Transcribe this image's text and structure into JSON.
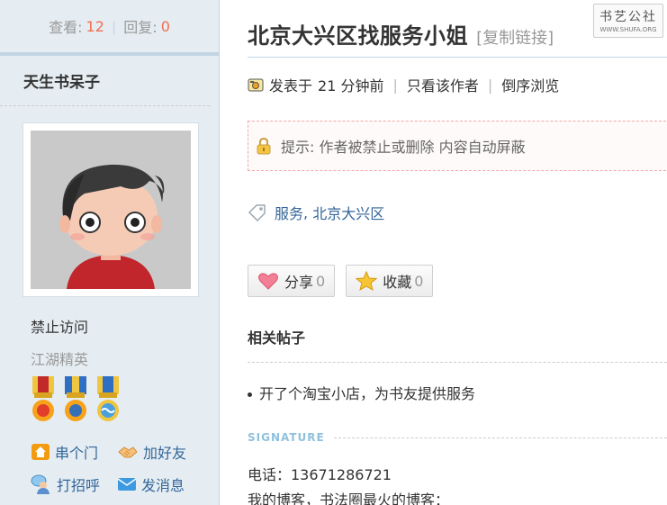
{
  "sidebar": {
    "views_label": "查看:",
    "views_count": "12",
    "separator": "|",
    "replies_label": "回复:",
    "replies_count": "0",
    "username": "天生书呆子",
    "status": "禁止访问",
    "rank": "江湖精英",
    "actions": [
      {
        "label": "串个门",
        "icon": "house-icon"
      },
      {
        "label": "加好友",
        "icon": "handshake-icon"
      },
      {
        "label": "打招呼",
        "icon": "chat-person-icon"
      },
      {
        "label": "发消息",
        "icon": "envelope-icon"
      }
    ]
  },
  "post": {
    "title": "北京大兴区找服务小姐",
    "copy_link": "[复制链接]",
    "posted_prefix": "发表于",
    "posted_time": "21 分钟前",
    "only_author": "只看该作者",
    "reverse_browse": "倒序浏览",
    "notice": "提示: 作者被禁止或删除 内容自动屏蔽",
    "tags": [
      "服务",
      "北京大兴区"
    ],
    "share_label": "分享",
    "share_count": "0",
    "favorite_label": "收藏",
    "favorite_count": "0"
  },
  "related": {
    "title": "相关帖子",
    "items": [
      "开了个淘宝小店，为书友提供服务"
    ]
  },
  "signature": {
    "label": "SIGNATURE",
    "phone": "电话：13671286721",
    "blog": "我的博客，书法圈最火的博客："
  },
  "logo": {
    "text": "书艺公社",
    "url_text": "WWW.SHUFA.ORG"
  },
  "colors": {
    "sidebar_bg": "#e5edf2",
    "accent_border": "#c2d5e3",
    "count_color": "#f26c4f",
    "link_color": "#336699"
  }
}
